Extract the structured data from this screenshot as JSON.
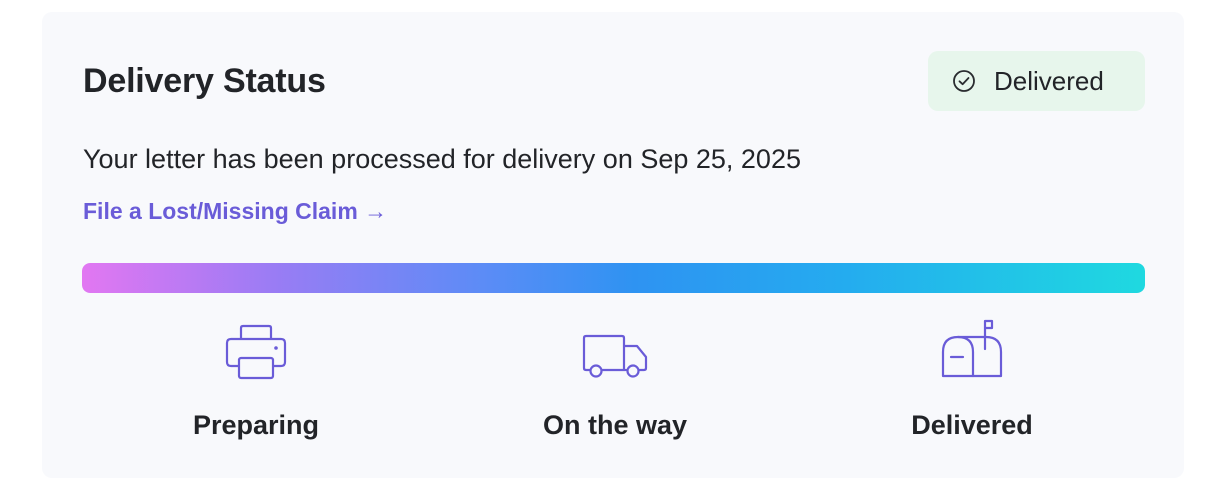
{
  "header": {
    "title": "Delivery Status"
  },
  "status_badge": {
    "label": "Delivered",
    "icon": "check-circle-icon",
    "background": "#e7f6ec"
  },
  "message": "Your letter has been processed for delivery on Sep 25, 2025",
  "claim_link": {
    "label": "File a Lost/Missing Claim →",
    "color": "#6a5cd8"
  },
  "progress": {
    "fraction": 1.0,
    "gradient_colors": [
      "#e277f2",
      "#5b8cf6",
      "#2e93f2",
      "#1fd9e0"
    ]
  },
  "steps": [
    {
      "label": "Preparing",
      "icon": "printer-icon"
    },
    {
      "label": "On the way",
      "icon": "truck-icon"
    },
    {
      "label": "Delivered",
      "icon": "mailbox-icon"
    }
  ],
  "colors": {
    "accent": "#6a5cd8",
    "icon_stroke": "#6a5cd8",
    "text": "#222428",
    "card_background": "#f8f9fc"
  }
}
